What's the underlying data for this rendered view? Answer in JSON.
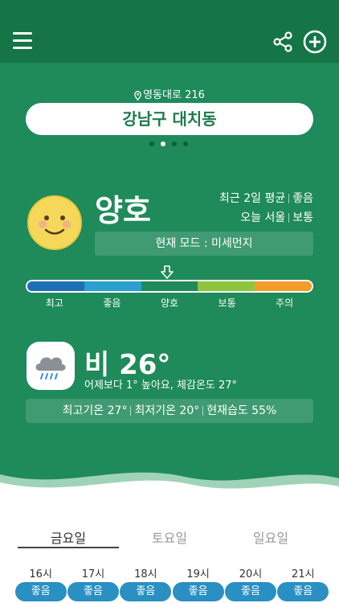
{
  "header": {
    "menu_icon": "hamburger-menu-icon",
    "share_icon": "share-icon",
    "add_icon": "add-circle-icon"
  },
  "location": {
    "address": "영동대로 216",
    "name": "강남구 대치동",
    "page_count": 4,
    "active_page": 1
  },
  "air_quality": {
    "face_icon": "smile-face-icon",
    "grade": "양호",
    "recent_label": "최근 2일 평균",
    "recent_value": "좋음",
    "today_label": "오늘 서울",
    "today_value": "보통",
    "mode": "현재 모드 : 미세먼지",
    "indicator_index": 2,
    "scale": [
      {
        "label": "최고",
        "color": "#1f6fb8"
      },
      {
        "label": "좋음",
        "color": "#2a9fd0"
      },
      {
        "label": "양호",
        "color": "#1f8a5a"
      },
      {
        "label": "보통",
        "color": "#8cc63f"
      },
      {
        "label": "주의",
        "color": "#f39c2a"
      }
    ]
  },
  "weather": {
    "icon": "cloud-rain-icon",
    "summary": "비 26°",
    "compare": "어제보다 1° 높아요, 체감온도 27°",
    "high": "최고기온 27°",
    "low": "최저기온 20°",
    "humidity": "현재습도 55%"
  },
  "forecast": {
    "tabs": [
      "금요일",
      "토요일",
      "일요일"
    ],
    "active_tab": 0,
    "hours": [
      {
        "time": "16시",
        "status": "좋음"
      },
      {
        "time": "17시",
        "status": "좋음"
      },
      {
        "time": "18시",
        "status": "좋음"
      },
      {
        "time": "19시",
        "status": "좋음"
      },
      {
        "time": "20시",
        "status": "좋음"
      },
      {
        "time": "21시",
        "status": "좋음"
      }
    ]
  },
  "colors": {
    "header_bg": "#157547",
    "main_bg": "#1f8a5a",
    "badge_good": "#2a8fc2"
  }
}
